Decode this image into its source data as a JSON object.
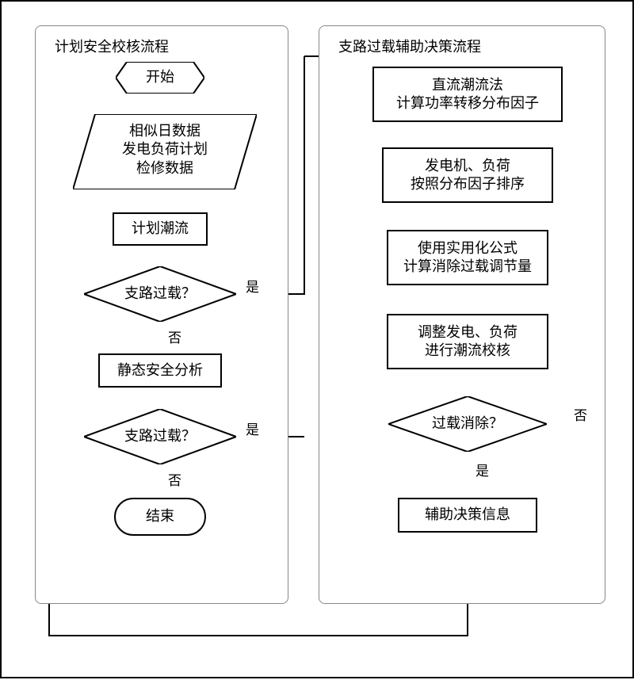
{
  "left_panel": {
    "title": "计划安全校核流程",
    "start": "开始",
    "input": "相似日数据\n发电负荷计划\n检修数据",
    "plan_flow": "计划潮流",
    "decision1": "支路过载？",
    "static_analysis": "静态安全分析",
    "decision2": "支路过载？",
    "end": "结束",
    "yes": "是",
    "no": "否"
  },
  "right_panel": {
    "title": "支路过载辅助决策流程",
    "step1": "直流潮流法\n计算功率转移分布因子",
    "step2": "发电机、负荷\n按照分布因子排序",
    "step3": "使用实用化公式\n计算消除过载调节量",
    "step4": "调整发电、负荷\n进行潮流校核",
    "decision": "过载消除？",
    "output": "辅助决策信息",
    "yes": "是",
    "no": "否"
  }
}
